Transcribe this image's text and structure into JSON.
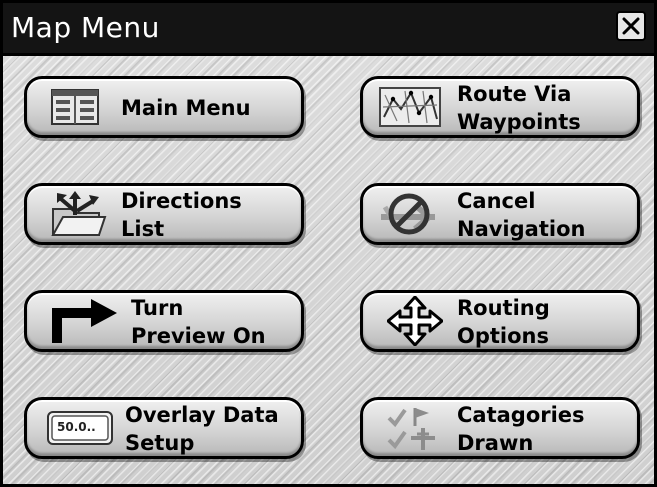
{
  "window": {
    "title": "Map Menu",
    "close_icon": "close-icon"
  },
  "buttons": [
    {
      "line1": "Main Menu",
      "line2": "",
      "icon": "menu-list-icon"
    },
    {
      "line1": "Route Via",
      "line2": "Waypoints",
      "icon": "map-route-icon"
    },
    {
      "line1": "Directions",
      "line2": "List",
      "icon": "directions-folder-icon"
    },
    {
      "line1": "Cancel",
      "line2": "Navigation",
      "icon": "cancel-navigation-icon"
    },
    {
      "line1": "Turn",
      "line2": "Preview On",
      "icon": "turn-arrow-icon"
    },
    {
      "line1": "Routing",
      "line2": "Options",
      "icon": "routing-options-icon"
    },
    {
      "line1": "Overlay Data",
      "line2": "Setup",
      "icon": "overlay-data-icon",
      "icon_text": "50.0.."
    },
    {
      "line1": "Catagories",
      "line2": "Drawn",
      "icon": "categories-icon"
    }
  ]
}
